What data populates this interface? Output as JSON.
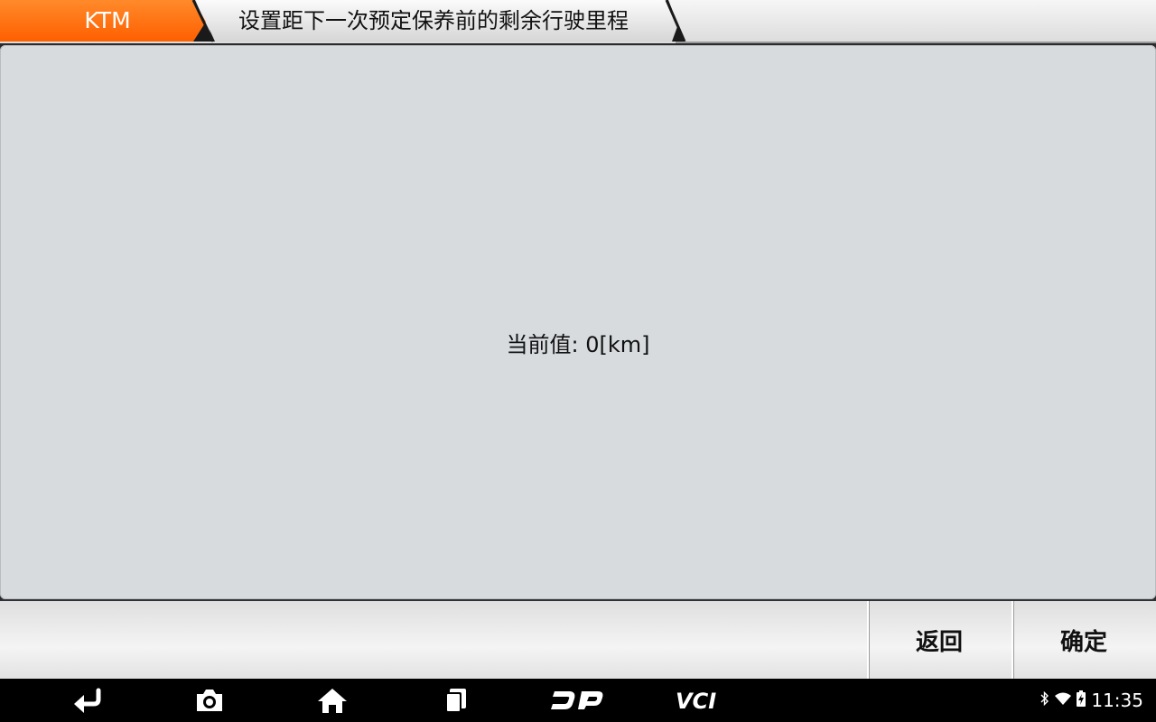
{
  "header": {
    "brand": "KTM",
    "title": "设置距下一次预定保养前的剩余行驶里程",
    "brand_color": "#ff6a00"
  },
  "content": {
    "current_value": "当前值: 0[km]"
  },
  "actions": {
    "back_label": "返回",
    "ok_label": "确定"
  },
  "navbar": {
    "icons": [
      "back-arrow-icon",
      "camera-icon",
      "home-icon",
      "recent-apps-icon",
      "dp-logo-icon",
      "vci-logo-icon"
    ],
    "dp_label": "DP",
    "vci_label": "VCI"
  },
  "status": {
    "icons": [
      "bluetooth-icon",
      "wifi-icon",
      "battery-charging-icon"
    ],
    "time": "11:35"
  }
}
